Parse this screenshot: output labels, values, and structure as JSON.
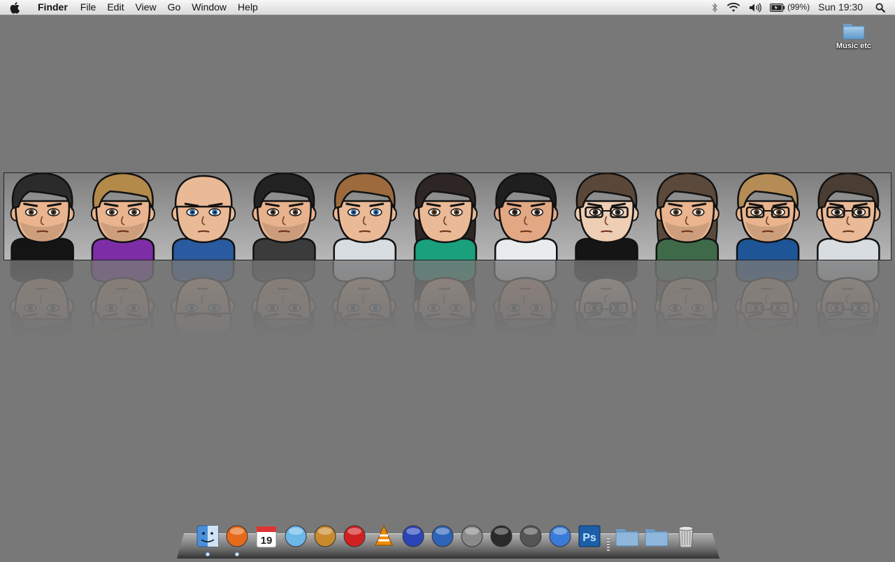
{
  "menubar": {
    "apple_icon": "apple-icon",
    "app_name": "Finder",
    "menus": [
      "File",
      "Edit",
      "View",
      "Go",
      "Window",
      "Help"
    ],
    "status": {
      "bluetooth_icon": "bluetooth-icon",
      "wifi_icon": "wifi-icon",
      "volume_icon": "volume-icon",
      "battery_icon": "battery-icon",
      "battery_percent": "(99%)",
      "clock": "Sun 19:30",
      "spotlight_icon": "spotlight-search-icon"
    }
  },
  "desktop": {
    "background_color": "#787878",
    "icons": [
      {
        "label": "Music etc",
        "icon": "folder-icon"
      }
    ]
  },
  "banner": {
    "avatars": [
      {
        "hair": "#2b2b2b",
        "skin": "#e9b48e",
        "shirt": "#141414",
        "eyes": "#5a3a22",
        "glasses": false,
        "beard": true,
        "bald": false,
        "long": false
      },
      {
        "hair": "#b38a4a",
        "skin": "#e9b48e",
        "shirt": "#7d2ea6",
        "eyes": "#5a3a22",
        "glasses": false,
        "beard": true,
        "bald": false,
        "long": false
      },
      {
        "hair": "#e7b792",
        "skin": "#eab996",
        "shirt": "#2a5aa0",
        "eyes": "#2c6fb4",
        "glasses": false,
        "beard": false,
        "bald": true,
        "long": false
      },
      {
        "hair": "#222222",
        "skin": "#e8b28c",
        "shirt": "#3b3b3b",
        "eyes": "#5a3a22",
        "glasses": false,
        "beard": true,
        "bald": false,
        "long": false
      },
      {
        "hair": "#9c6a3c",
        "skin": "#eab996",
        "shirt": "#d8dde1",
        "eyes": "#2c6fb4",
        "glasses": false,
        "beard": false,
        "bald": false,
        "long": false
      },
      {
        "hair": "#2e2624",
        "skin": "#eab996",
        "shirt": "#1aa07c",
        "eyes": "#6a4326",
        "glasses": false,
        "beard": false,
        "bald": false,
        "long": true
      },
      {
        "hair": "#1f1f1f",
        "skin": "#e2a884",
        "shirt": "#e9ecee",
        "eyes": "#3a2a1e",
        "glasses": false,
        "beard": false,
        "bald": false,
        "long": false
      },
      {
        "hair": "#5a4738",
        "skin": "#eeceb4",
        "shirt": "#151515",
        "eyes": "#3a2a1e",
        "glasses": true,
        "beard": false,
        "bald": false,
        "long": false
      },
      {
        "hair": "#5b4a3c",
        "skin": "#e9b48e",
        "shirt": "#3f6a4a",
        "eyes": "#5a3a22",
        "glasses": false,
        "beard": true,
        "bald": false,
        "long": true
      },
      {
        "hair": "#b58c55",
        "skin": "#e9b48e",
        "shirt": "#1e5597",
        "eyes": "#5a3a22",
        "glasses": true,
        "beard": true,
        "bald": false,
        "long": false
      },
      {
        "hair": "#4a3d33",
        "skin": "#eab996",
        "shirt": "#d8dde1",
        "eyes": "#3a2a1e",
        "glasses": true,
        "beard": false,
        "bald": false,
        "long": false
      }
    ]
  },
  "dock": {
    "items": [
      {
        "icon": "finder-icon",
        "color": "#4a90d9",
        "running": true
      },
      {
        "icon": "firefox-icon",
        "color": "#e66a1a",
        "running": true
      },
      {
        "icon": "ical-icon",
        "color": "#ffffff",
        "running": false,
        "text": "19"
      },
      {
        "icon": "itunes-icon",
        "color": "#6bb7e8",
        "running": false
      },
      {
        "icon": "iphoto-icon",
        "color": "#c98a2e",
        "running": false
      },
      {
        "icon": "transmission-icon",
        "color": "#d12020",
        "running": false
      },
      {
        "icon": "vlc-icon",
        "color": "#f08a00",
        "running": false
      },
      {
        "icon": "cyberduck-icon",
        "color": "#2b45b8",
        "running": false
      },
      {
        "icon": "globe-icon",
        "color": "#2e64b8",
        "running": false
      },
      {
        "icon": "system-preferences-icon",
        "color": "#8a8a8a",
        "running": false
      },
      {
        "icon": "video-editor-icon",
        "color": "#2a2a2a",
        "running": false
      },
      {
        "icon": "disk-utility-icon",
        "color": "#555555",
        "running": false
      },
      {
        "icon": "word-icon",
        "color": "#3a7ad8",
        "running": false
      },
      {
        "icon": "photoshop-icon",
        "color": "#1d5ea8",
        "running": false,
        "text": "Ps"
      },
      {
        "separator": true
      },
      {
        "icon": "applications-folder-icon",
        "color": "#8fb7dc",
        "running": false
      },
      {
        "icon": "documents-folder-icon",
        "color": "#8fb7dc",
        "running": false
      },
      {
        "icon": "trash-icon",
        "color": "#bdbdbd",
        "running": false
      }
    ]
  }
}
